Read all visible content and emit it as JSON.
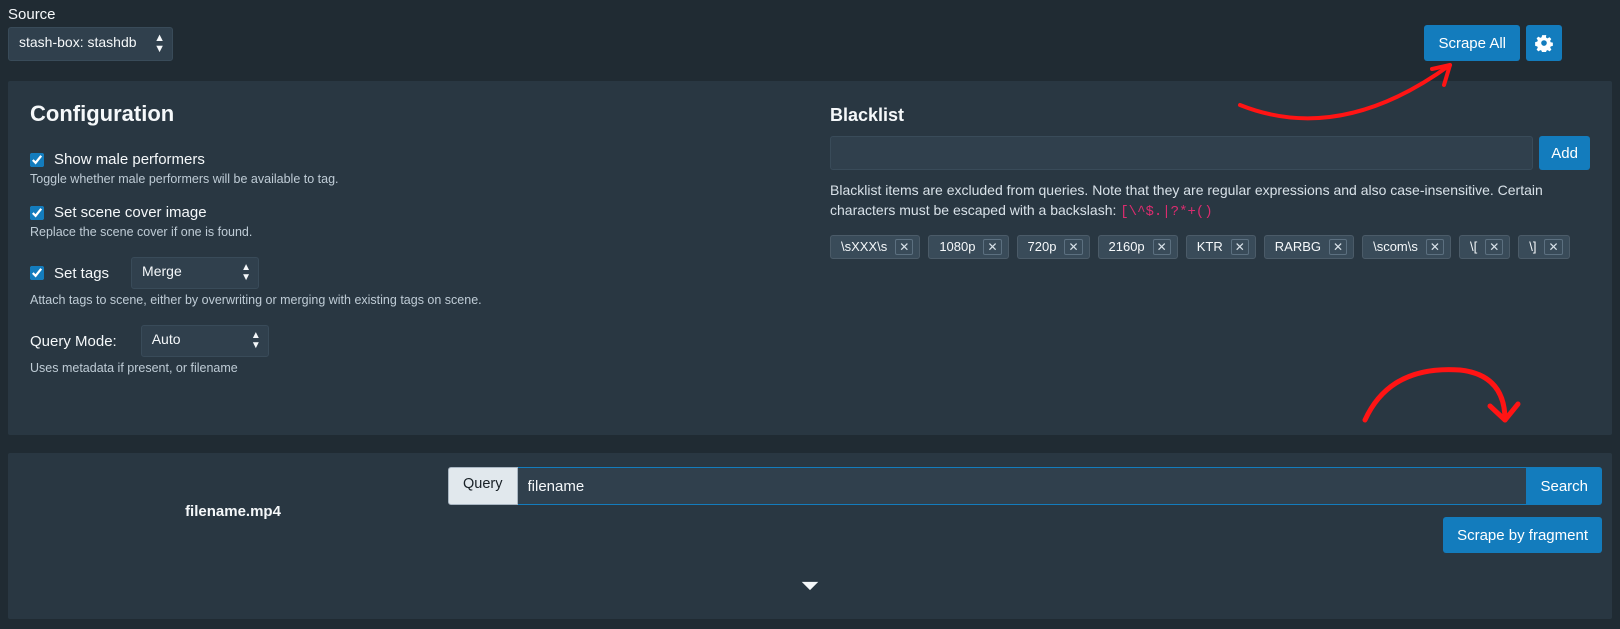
{
  "source": {
    "label": "Source",
    "selected": "stash-box: stashdb"
  },
  "buttons": {
    "scrape_all": "Scrape All",
    "add": "Add",
    "search": "Search",
    "scrape_by_fragment": "Scrape by fragment"
  },
  "config": {
    "title": "Configuration",
    "show_male": {
      "label": "Show male performers",
      "desc": "Toggle whether male performers will be available to tag."
    },
    "cover": {
      "label": "Set scene cover image",
      "desc": "Replace the scene cover if one is found."
    },
    "tags": {
      "label": "Set tags",
      "mode": "Merge",
      "desc": "Attach tags to scene, either by overwriting or merging with existing tags on scene."
    },
    "query_mode": {
      "label": "Query Mode:",
      "value": "Auto",
      "desc": "Uses metadata if present, or filename"
    }
  },
  "blacklist": {
    "title": "Blacklist",
    "note_prefix": "Blacklist items are excluded from queries. Note that they are regular expressions and also case-insensitive. Certain characters must be escaped with a backslash: ",
    "escaped_chars": "[\\^$.|?*+()",
    "items": [
      "\\sXXX\\s",
      "1080p",
      "720p",
      "2160p",
      "KTR",
      "RARBG",
      "\\scom\\s",
      "\\[",
      "\\]"
    ]
  },
  "scene": {
    "filename": "filename.mp4",
    "query_label": "Query",
    "query_value": "filename"
  }
}
